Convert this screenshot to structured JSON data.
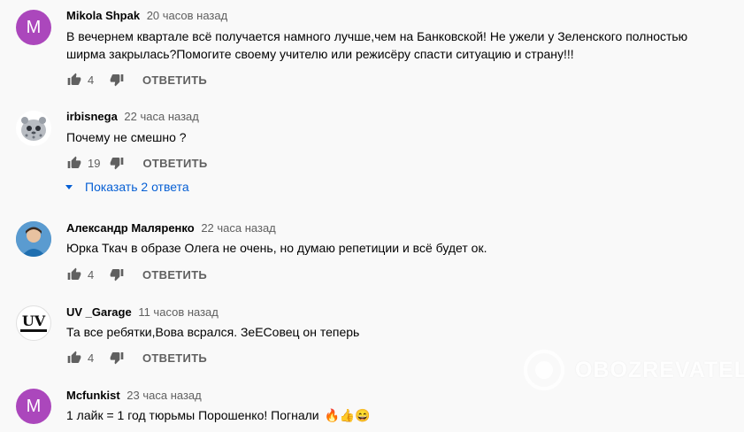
{
  "comments": [
    {
      "author": "Mikola Shpak",
      "time": "20 часов назад",
      "avatar_letter": "M",
      "text_line1": "В вечернем квартале всё получается намного лучше,чем на Банковской! Не ужели у Зеленского полностью",
      "text_line2": "ширма закрылась?Помогите своему учителю или режисёру спасти ситуацию и страну!!!",
      "likes": "4",
      "reply_label": "ОТВЕТИТЬ"
    },
    {
      "author": "irbisnega",
      "time": "22 часа назад",
      "text": "Почему не смешно ?",
      "likes": "19",
      "reply_label": "ОТВЕТИТЬ",
      "show_replies": "Показать 2 ответа"
    },
    {
      "author": "Александр Маляренко",
      "time": "22 часа назад",
      "text": "Юрка Ткач в образе Олега не очень, но думаю репетиции и всё будет ок.",
      "likes": "4",
      "reply_label": "ОТВЕТИТЬ"
    },
    {
      "author": "UV _Garage",
      "time": "11 часов назад",
      "avatar_text": "UV",
      "text": "Та все ребятки,Вова всрался. ЗеЕСовец он теперь",
      "likes": "4",
      "reply_label": "ОТВЕТИТЬ"
    },
    {
      "author": "Mcfunkist",
      "time": "23 часа назад",
      "avatar_letter": "M",
      "text": "1 лайк = 1 год тюрьмы Порошенко! Погнали",
      "emojis": "🔥👍😄"
    }
  ],
  "watermark": {
    "text": "OBOZREVATEL"
  },
  "icons": {
    "like": "thumbs-up-icon",
    "dislike": "thumbs-down-icon",
    "expand": "triangle-down-icon"
  },
  "colors": {
    "avatar_purple": "#ab47bc",
    "link_blue": "#065fd4",
    "muted": "#606060"
  }
}
